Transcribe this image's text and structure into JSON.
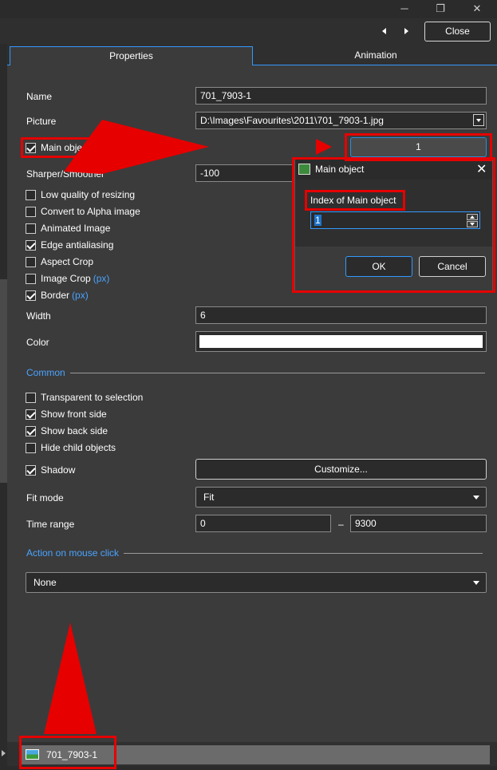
{
  "window": {
    "minimize_glyph": "─",
    "restore_glyph": "❐",
    "close_glyph": "✕"
  },
  "toolbar": {
    "prev_icon": "arrow-left-icon",
    "next_icon": "arrow-right-icon",
    "close_label": "Close"
  },
  "tabs": [
    {
      "label": "Properties",
      "active": true
    },
    {
      "label": "Animation",
      "active": false
    }
  ],
  "properties": {
    "name_label": "Name",
    "name_value": "701_7903-1",
    "picture_label": "Picture",
    "picture_value": "D:\\Images\\Favourites\\2011\\701_7903-1.jpg",
    "main_object_label": "Main object",
    "main_object_checked": true,
    "main_object_value": "1",
    "sharper_label": "Sharper/Smoother",
    "sharper_value": "-100",
    "checkboxes": [
      {
        "label": "Low quality of resizing",
        "checked": false
      },
      {
        "label": "Convert to Alpha image",
        "checked": false
      },
      {
        "label": "Animated Image",
        "checked": false
      },
      {
        "label": "Edge antialiasing",
        "checked": true
      },
      {
        "label": "Aspect Crop",
        "checked": false
      },
      {
        "label": "Image Crop",
        "suffix": "(px)",
        "checked": false
      },
      {
        "label": "Border",
        "suffix": "(px)",
        "checked": true
      }
    ],
    "width_label": "Width",
    "width_value": "6",
    "color_label": "Color",
    "color_value": "#ffffff"
  },
  "common": {
    "section_label": "Common",
    "checkboxes": [
      {
        "label": "Transparent to selection",
        "checked": false
      },
      {
        "label": "Show front side",
        "checked": true
      },
      {
        "label": "Show back side",
        "checked": true
      },
      {
        "label": "Hide child objects",
        "checked": false
      }
    ],
    "shadow_label": "Shadow",
    "shadow_checked": true,
    "customize_label": "Customize...",
    "fit_mode_label": "Fit mode",
    "fit_mode_value": "Fit",
    "time_range_label": "Time range",
    "time_start": "0",
    "time_separator": "–",
    "time_end": "9300"
  },
  "mouse_click": {
    "section_label": "Action on mouse click",
    "value": "None"
  },
  "dialog": {
    "title": "Main object",
    "close_glyph": "✕",
    "field_label": "Index of Main object",
    "index_value": "1",
    "ok_label": "OK",
    "cancel_label": "Cancel"
  },
  "bottom": {
    "item_label": "701_7903-1"
  },
  "colors": {
    "accent": "#3399ff",
    "annotation": "#e60000",
    "background": "#3b3b3b"
  }
}
